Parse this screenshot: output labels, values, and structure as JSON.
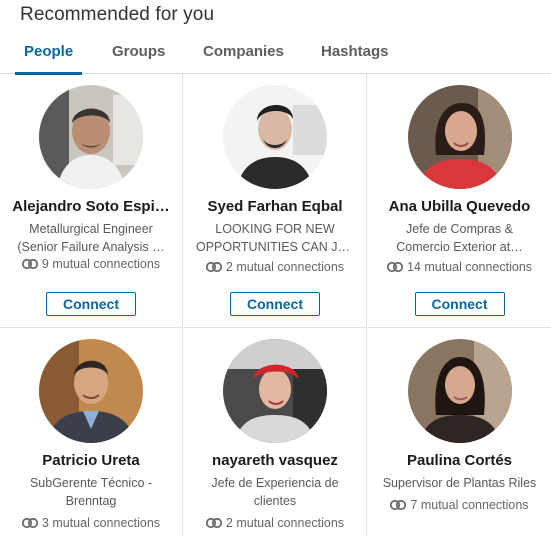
{
  "header": {
    "title": "Recommended for you"
  },
  "tabs": [
    {
      "label": "People"
    },
    {
      "label": "Groups"
    },
    {
      "label": "Companies"
    },
    {
      "label": "Hashtags"
    }
  ],
  "connect_label": "Connect",
  "people": [
    {
      "name": "Alejandro Soto Espi…",
      "line1": "Metallurgical Engineer",
      "line2": "(Senior Failure Analysis …",
      "mutual": "9 mutual connections"
    },
    {
      "name": "Syed Farhan Eqbal",
      "line1": "LOOKING FOR NEW",
      "line2": "OPPORTUNITIES CAN JOI…",
      "mutual": "2 mutual connections"
    },
    {
      "name": "Ana Ubilla Quevedo",
      "line1": "Jefe de Compras &",
      "line2": "Comercio Exterior at…",
      "mutual": "14 mutual connections"
    },
    {
      "name": "Patricio Ureta",
      "line1": "SubGerente Técnico -",
      "line2": "Brenntag",
      "mutual": "3 mutual connections"
    },
    {
      "name": "nayareth vasquez",
      "line1": "Jefe de Experiencia de",
      "line2": "clientes",
      "mutual": "2 mutual connections"
    },
    {
      "name": "Paulina Cortés",
      "line1": "Supervisor de Plantas Riles",
      "line2": "",
      "mutual": "7 mutual connections"
    }
  ],
  "colors": {
    "accent": "#0a66a2",
    "divider": "#e2e2e2"
  }
}
